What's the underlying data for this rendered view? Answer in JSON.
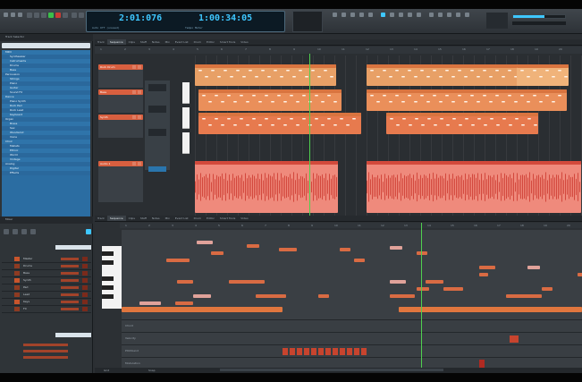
{
  "transport": {
    "time_display": "2:01:076",
    "clock_display": "1:00:34:05",
    "lcd_sub_1": "Auto Off   (unused)",
    "lcd_sub_2": "Tempo   Meter"
  },
  "tabs_top": [
    "Track",
    "Sequence",
    "Clips",
    "Staff",
    "Notes",
    "Mix",
    "Event List",
    "Drum",
    "Editor",
    "Smart Tools",
    "Video"
  ],
  "tabs_bottom": [
    "Track",
    "Sequence",
    "Clips",
    "Staff",
    "Notes",
    "Mix",
    "Event List",
    "Drum",
    "Editor",
    "Smart Tools",
    "Video"
  ],
  "browser": {
    "title": "Track Selector",
    "items": [
      "MIDI",
      "Synthesizer",
      "Instruments",
      "Drums",
      "Bass",
      "Percussion",
      "Strings",
      "Piano",
      "Guitar",
      "Sound FX",
      "Dance",
      "Piano Synth",
      "Rock Pad",
      "Rock Lead",
      "Keyboard",
      "Organ",
      "Brass",
      "Sax",
      "Woodwind",
      "Voice",
      "Choir",
      "Mallets",
      "Ethnic",
      "World",
      "Vintage",
      "Analog",
      "Digital",
      "Effects"
    ]
  },
  "tracks": [
    {
      "name": "Rock Drum"
    },
    {
      "name": "Bass"
    },
    {
      "name": "Synth"
    },
    {
      "name": "Audio 1"
    }
  ],
  "clip_names": [
    "Clip",
    "Clip",
    "Clip",
    "Clip",
    "Clip",
    "Clip",
    "Clip",
    "Clip"
  ],
  "lower_left": {
    "title": "Mixer",
    "rows": [
      "Master",
      "Drums",
      "Bass",
      "Synth",
      "Pad",
      "Lead",
      "Keys",
      "FX"
    ]
  },
  "lanes": [
    "Chord",
    "Velocity",
    "Pitchbend",
    "Modulation"
  ],
  "ruler_marks": [
    "1",
    "2",
    "3",
    "4",
    "5",
    "6",
    "7",
    "8",
    "9",
    "10",
    "11",
    "12",
    "13",
    "14",
    "15",
    "16",
    "17",
    "18",
    "19",
    "20"
  ],
  "status": {
    "zoom_label": "Grid",
    "snap_label": "Snap"
  },
  "colors": {
    "accent": "#3ec7ff",
    "clip_orange": "#e48a4e",
    "audio_red": "#e2564a",
    "browser_blue": "#2b6da2"
  }
}
